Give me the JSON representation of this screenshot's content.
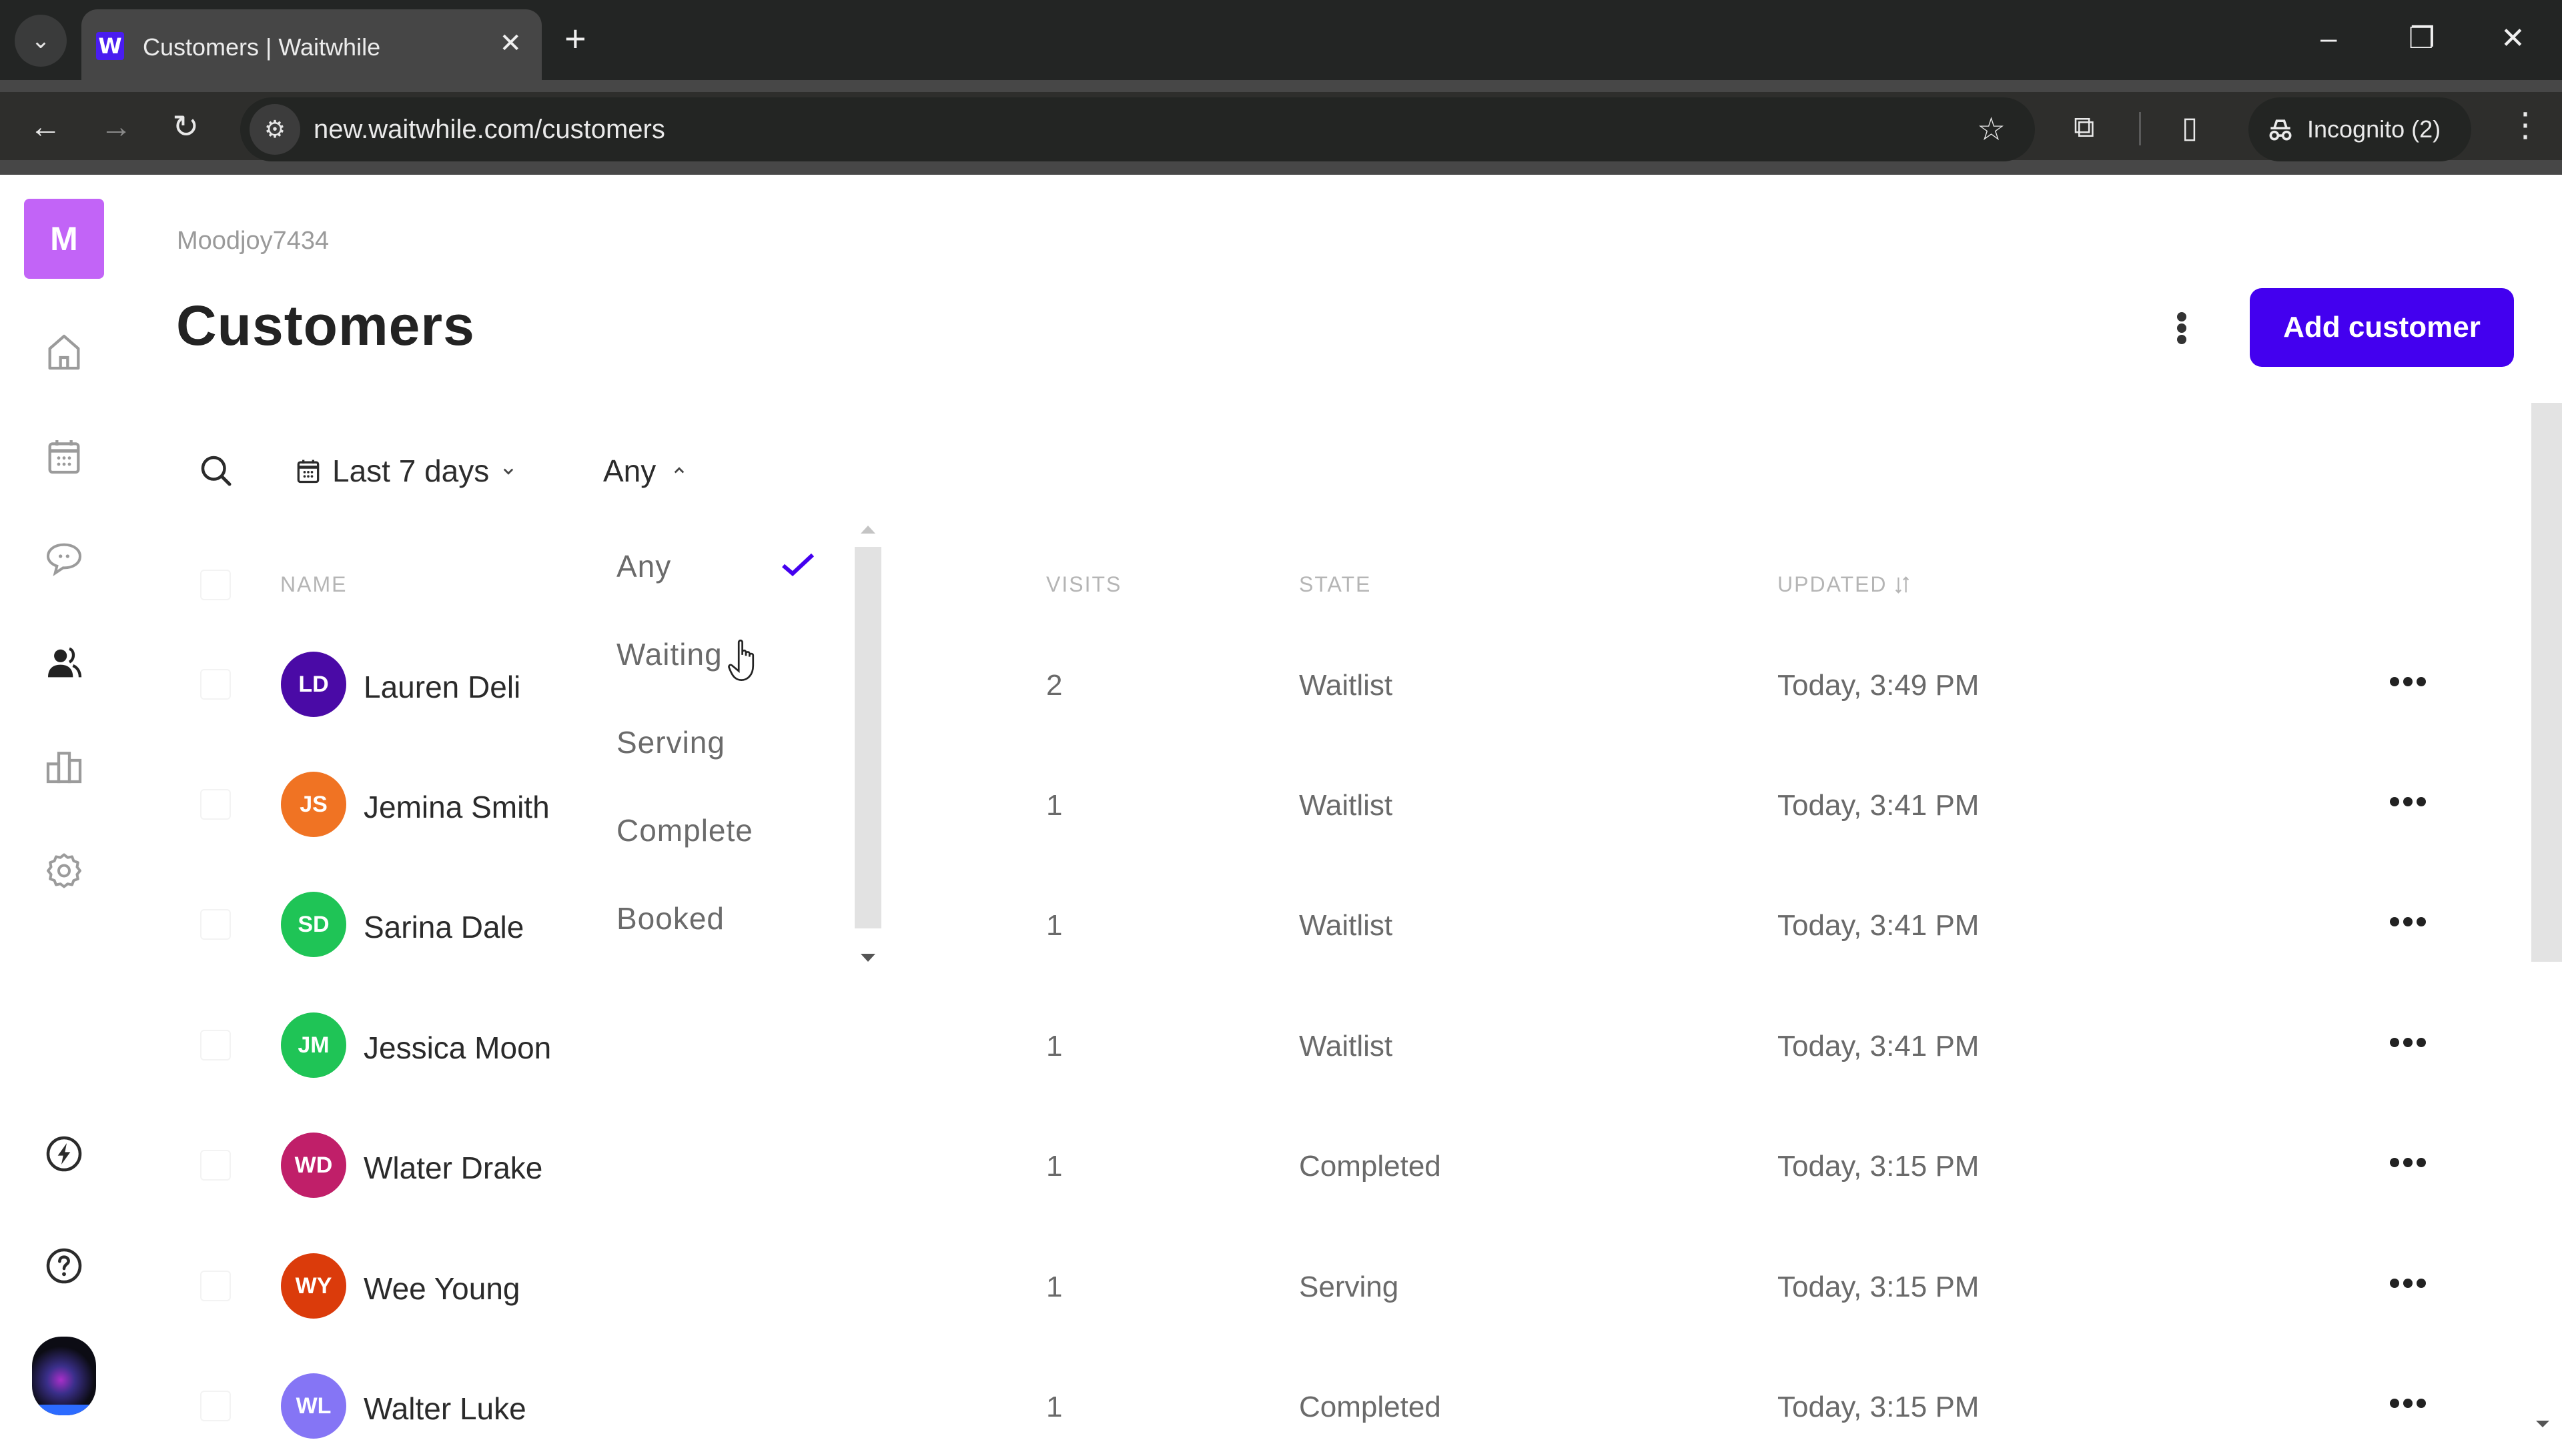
{
  "browser": {
    "tab_title": "Customers | Waitwhile",
    "favicon_letter": "W",
    "url": "new.waitwhile.com/customers",
    "incognito_label": "Incognito (2)",
    "icons": {
      "tab_search": "chevron-down-icon",
      "close_tab": "close-icon",
      "new_tab": "plus-icon",
      "back": "arrow-left-icon",
      "forward": "arrow-right-icon",
      "reload": "reload-icon",
      "site_info": "tune-icon",
      "bookmark": "star-icon",
      "extensions": "puzzle-icon",
      "side_panel": "side-panel-icon",
      "incognito": "incognito-icon",
      "menu": "more-vertical-icon",
      "minimize": "minimize-icon",
      "restore": "restore-icon",
      "close_window": "close-icon"
    },
    "glyphs": {
      "tab_search": "⌄",
      "close_tab": "✕",
      "new_tab": "+",
      "back": "←",
      "forward": "→",
      "reload": "↻",
      "site_info": "⚙",
      "bookmark": "☆",
      "extensions": "⧉",
      "side_panel": "▯",
      "menu": "⋮",
      "minimize": "–",
      "restore": "❐",
      "close_window": "✕"
    }
  },
  "sidebar": {
    "org_initial": "M",
    "org_color": "#c264f7",
    "items": [
      {
        "name": "home",
        "icon": "home-icon",
        "active": false
      },
      {
        "name": "calendar",
        "icon": "calendar-icon",
        "active": false
      },
      {
        "name": "messages",
        "icon": "chat-icon",
        "active": false
      },
      {
        "name": "customers",
        "icon": "users-icon",
        "active": true
      },
      {
        "name": "analytics",
        "icon": "bar-chart-icon",
        "active": false
      },
      {
        "name": "settings",
        "icon": "gear-icon",
        "active": false
      }
    ],
    "bottom_items": [
      {
        "name": "whats-new",
        "icon": "bolt-icon"
      },
      {
        "name": "help",
        "icon": "help-icon"
      },
      {
        "name": "user-profile",
        "icon": "avatar"
      }
    ]
  },
  "header": {
    "breadcrumb": "Moodjoy7434",
    "title": "Customers",
    "add_button_label": "Add customer",
    "accent_color": "#4300ef"
  },
  "filters": {
    "date_range": "Last 7 days",
    "state": "Any"
  },
  "state_dropdown": {
    "open": true,
    "selected": "Any",
    "options": [
      "Any",
      "Waiting",
      "Serving",
      "Complete",
      "Booked"
    ],
    "hovered": "Waiting"
  },
  "table": {
    "columns": [
      "NAME",
      "VISITS",
      "STATE",
      "UPDATED"
    ],
    "sort_column": "UPDATED",
    "rows": [
      {
        "initials": "LD",
        "name": "Lauren Deli",
        "visits": "2",
        "state": "Waitlist",
        "updated": "Today, 3:49 PM",
        "color": "#4a0aa6"
      },
      {
        "initials": "JS",
        "name": "Jemina Smith",
        "visits": "1",
        "state": "Waitlist",
        "updated": "Today, 3:41 PM",
        "color": "#f07323"
      },
      {
        "initials": "SD",
        "name": "Sarina Dale",
        "visits": "1",
        "state": "Waitlist",
        "updated": "Today, 3:41 PM",
        "color": "#1fc456"
      },
      {
        "initials": "JM",
        "name": "Jessica Moon",
        "visits": "1",
        "state": "Waitlist",
        "updated": "Today, 3:41 PM",
        "color": "#1fc456"
      },
      {
        "initials": "WD",
        "name": "Wlater Drake",
        "visits": "1",
        "state": "Completed",
        "updated": "Today, 3:15 PM",
        "color": "#c01f69"
      },
      {
        "initials": "WY",
        "name": "Wee Young",
        "visits": "1",
        "state": "Serving",
        "updated": "Today, 3:15 PM",
        "color": "#db3b0b"
      },
      {
        "initials": "WL",
        "name": "Walter Luke",
        "visits": "1",
        "state": "Completed",
        "updated": "Today, 3:15 PM",
        "color": "#8575f5"
      }
    ]
  }
}
